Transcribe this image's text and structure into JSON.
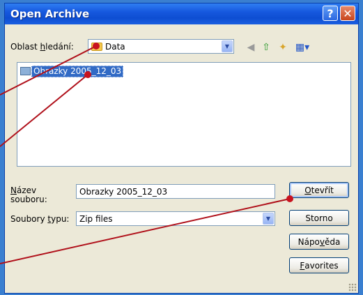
{
  "window": {
    "title": "Open Archive",
    "help_glyph": "?",
    "close_glyph": "✕"
  },
  "look_in": {
    "label_pre": "Oblast ",
    "label_ul": "h",
    "label_post": "ledání:",
    "value": "Data"
  },
  "toolbar": {
    "icons": [
      "back-icon",
      "up-folder-icon",
      "new-folder-icon",
      "view-menu-icon"
    ]
  },
  "files": [
    {
      "name": "Obrazky 2005_12_03",
      "icon": "folder-icon",
      "selected": true
    }
  ],
  "filename": {
    "label_ul": "N",
    "label_rest": "ázev",
    "label_line2": "souboru:",
    "value": "Obrazky 2005_12_03"
  },
  "filetype": {
    "label_pre": "Soubory ",
    "label_ul": "t",
    "label_post": "ypu:",
    "value": "Zip files"
  },
  "buttons": {
    "open": {
      "ul": "O",
      "rest": "tevřít"
    },
    "cancel": {
      "label": "Storno"
    },
    "help": {
      "pre": "Nápo",
      "ul": "v",
      "post": "ěda"
    },
    "favorites": {
      "ul": "F",
      "rest": "avorites"
    }
  },
  "colors": {
    "title_bar": "#1658de",
    "annotation_line": "#b0101a",
    "selection": "#316ac5"
  }
}
